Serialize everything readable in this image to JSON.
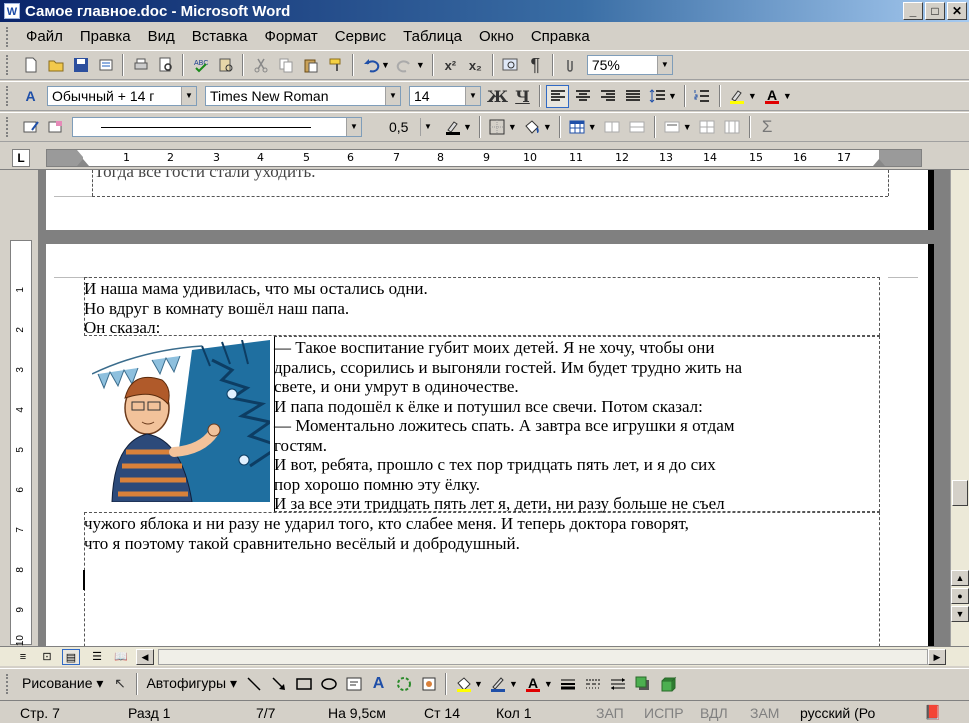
{
  "window": {
    "title": "Самое главное.doc - Microsoft Word",
    "icon_label": "W",
    "min": "_",
    "max": "□",
    "close": "✕"
  },
  "menu": [
    "Файл",
    "Правка",
    "Вид",
    "Вставка",
    "Формат",
    "Сервис",
    "Таблица",
    "Окно",
    "Справка"
  ],
  "toolbar_standard": {
    "zoom": "75%"
  },
  "toolbar_format": {
    "style": "Обычный + 14 г",
    "font": "Times New Roman",
    "size": "14",
    "bold": "Ж",
    "underline": "Ч"
  },
  "toolbar_tables": {
    "line_weight": "0,5"
  },
  "ruler": {
    "tab_marker": "L",
    "numbers": [
      "1",
      "2",
      "3",
      "4",
      "5",
      "6",
      "7",
      "8",
      "9",
      "10",
      "11",
      "12",
      "13",
      "14",
      "15",
      "16",
      "17"
    ]
  },
  "vruler": {
    "numbers": [
      "1",
      "2",
      "3",
      "4",
      "5",
      "6",
      "7",
      "8",
      "9",
      "10"
    ]
  },
  "document": {
    "page1_cut_line": "Тогда всё гости стали уходить.",
    "lines_top": [
      "И наша мама удивилась, что мы остались одни.",
      "Но вдруг в комнату вошёл наш папа.",
      "Он сказал:"
    ],
    "lines_wrap": [
      "— Такое воспитание губит моих детей. Я не хочу, чтобы они",
      "дрались, ссорились и выгоняли гостей. Им будет трудно жить на",
      "свете, и они умрут в одиночестве.",
      "И папа подошёл к ёлке и потушил все свечи. Потом сказал:",
      "— Моментально ложитесь спать. А завтра все игрушки я отдам",
      "гостям.",
      "И вот, ребята, прошло с тех пор тридцать пять лет, и я до сих",
      "пор хорошо помню эту ёлку.",
      "И за все эти тридцать пять лет я, дети, ни разу больше не съел"
    ],
    "lines_bottom": [
      "чужого яблока и ни разу не ударил того, кто слабее меня. И теперь доктора говорят,",
      "что я поэтому такой сравнительно весёлый и добродушный."
    ]
  },
  "drawing_toolbar": {
    "drawing": "Рисование",
    "autoshapes": "Автофигуры"
  },
  "status": {
    "page": "Стр. 7",
    "section": "Разд 1",
    "pages": "7/7",
    "at": "На 9,5см",
    "line": "Ст 14",
    "col": "Кол 1",
    "rec": "ЗАП",
    "trk": "ИСПР",
    "ext": "ВДЛ",
    "ovr": "ЗАМ",
    "lang": "русский (Ро"
  },
  "colors": {
    "title_start": "#0a246a",
    "title_end": "#a6caf0",
    "chrome": "#d4d0c8",
    "workspace": "#808080"
  }
}
